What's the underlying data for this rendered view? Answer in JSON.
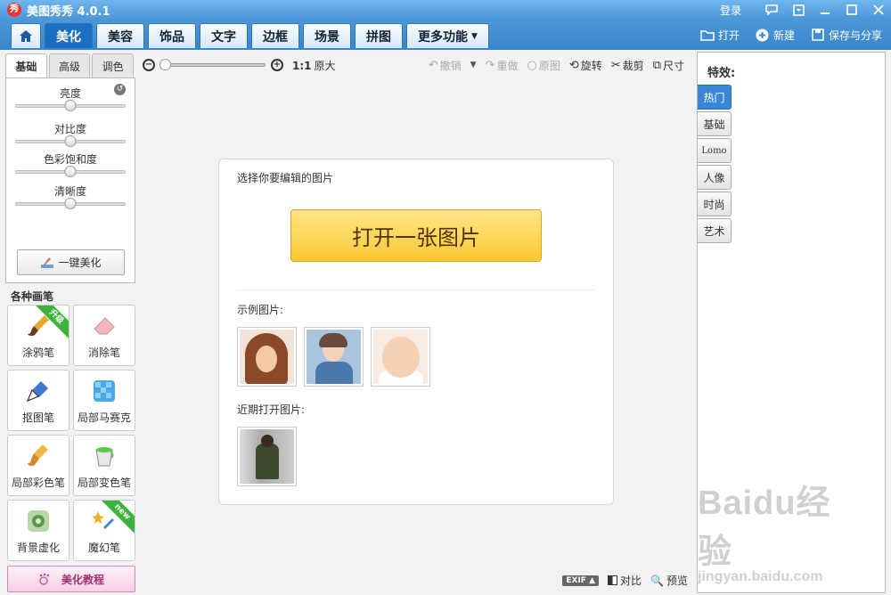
{
  "window": {
    "app_logo": "秀",
    "title": "美图秀秀 4.0.1",
    "login": "登录"
  },
  "menu": {
    "tabs": [
      {
        "label": "美化"
      },
      {
        "label": "美容"
      },
      {
        "label": "饰品"
      },
      {
        "label": "文字"
      },
      {
        "label": "边框"
      },
      {
        "label": "场景"
      },
      {
        "label": "拼图"
      },
      {
        "label": "更多功能"
      }
    ],
    "right": {
      "open": "打开",
      "new": "新建",
      "save_share": "保存与分享"
    }
  },
  "left": {
    "subtabs": [
      "基础",
      "高级",
      "调色"
    ],
    "sliders": [
      {
        "label": "亮度",
        "value": 0.5
      },
      {
        "label": "对比度",
        "value": 0.5
      },
      {
        "label": "色彩饱和度",
        "value": 0.5
      },
      {
        "label": "清晰度",
        "value": 0.5
      }
    ],
    "onekey": "一键美化",
    "brushes_title": "各种画笔",
    "brushes": [
      {
        "label": "涂鸦笔",
        "badge": "升级"
      },
      {
        "label": "消除笔",
        "badge": ""
      },
      {
        "label": "抠图笔",
        "badge": ""
      },
      {
        "label": "局部马赛克",
        "badge": ""
      },
      {
        "label": "局部彩色笔",
        "badge": ""
      },
      {
        "label": "局部变色笔",
        "badge": ""
      },
      {
        "label": "背景虚化",
        "badge": ""
      },
      {
        "label": "魔幻笔",
        "badge": "new"
      }
    ],
    "tutorial": "美化教程"
  },
  "toolbar": {
    "ratio": "1:1",
    "original_size": "原大",
    "undo": "撤销",
    "redo": "重做",
    "original": "原图",
    "rotate": "旋转",
    "crop": "裁剪",
    "size": "尺寸"
  },
  "canvas": {
    "choose_prompt": "选择你要编辑的图片",
    "open_button": "打开一张图片",
    "sample_label": "示例图片:",
    "recent_label": "近期打开图片:"
  },
  "bottom": {
    "exif": "EXIF",
    "compare": "对比",
    "preview": "预览"
  },
  "effects": {
    "title": "特效:",
    "tabs": [
      "热门",
      "基础",
      "Lomo",
      "人像",
      "时尚",
      "艺术"
    ]
  },
  "watermark": {
    "main": "Baidu经验",
    "sub": "jingyan.baidu.com"
  },
  "colors": {
    "accent": "#1b6fc2",
    "open_button": "#fbc933"
  }
}
